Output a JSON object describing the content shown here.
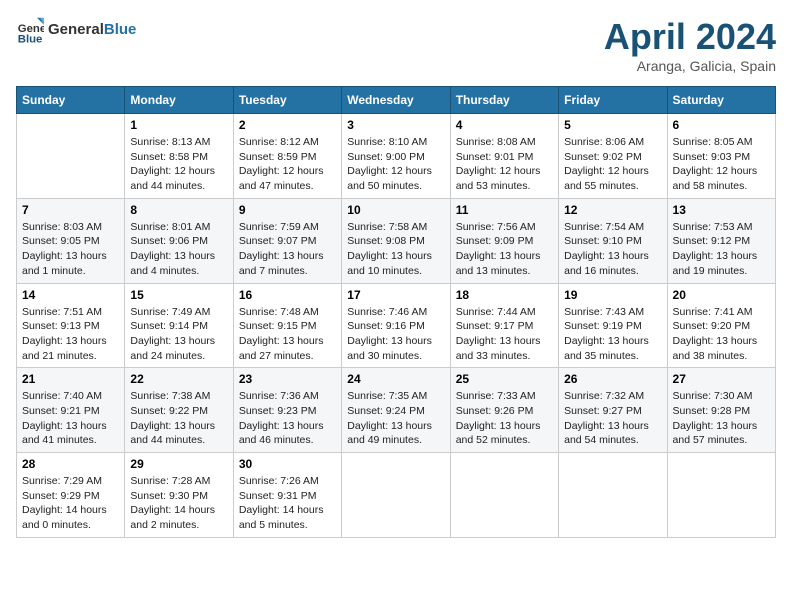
{
  "header": {
    "logo_general": "General",
    "logo_blue": "Blue",
    "month_title": "April 2024",
    "subtitle": "Aranga, Galicia, Spain"
  },
  "columns": [
    "Sunday",
    "Monday",
    "Tuesday",
    "Wednesday",
    "Thursday",
    "Friday",
    "Saturday"
  ],
  "weeks": [
    [
      {
        "day": "",
        "info": ""
      },
      {
        "day": "1",
        "info": "Sunrise: 8:13 AM\nSunset: 8:58 PM\nDaylight: 12 hours\nand 44 minutes."
      },
      {
        "day": "2",
        "info": "Sunrise: 8:12 AM\nSunset: 8:59 PM\nDaylight: 12 hours\nand 47 minutes."
      },
      {
        "day": "3",
        "info": "Sunrise: 8:10 AM\nSunset: 9:00 PM\nDaylight: 12 hours\nand 50 minutes."
      },
      {
        "day": "4",
        "info": "Sunrise: 8:08 AM\nSunset: 9:01 PM\nDaylight: 12 hours\nand 53 minutes."
      },
      {
        "day": "5",
        "info": "Sunrise: 8:06 AM\nSunset: 9:02 PM\nDaylight: 12 hours\nand 55 minutes."
      },
      {
        "day": "6",
        "info": "Sunrise: 8:05 AM\nSunset: 9:03 PM\nDaylight: 12 hours\nand 58 minutes."
      }
    ],
    [
      {
        "day": "7",
        "info": "Sunrise: 8:03 AM\nSunset: 9:05 PM\nDaylight: 13 hours\nand 1 minute."
      },
      {
        "day": "8",
        "info": "Sunrise: 8:01 AM\nSunset: 9:06 PM\nDaylight: 13 hours\nand 4 minutes."
      },
      {
        "day": "9",
        "info": "Sunrise: 7:59 AM\nSunset: 9:07 PM\nDaylight: 13 hours\nand 7 minutes."
      },
      {
        "day": "10",
        "info": "Sunrise: 7:58 AM\nSunset: 9:08 PM\nDaylight: 13 hours\nand 10 minutes."
      },
      {
        "day": "11",
        "info": "Sunrise: 7:56 AM\nSunset: 9:09 PM\nDaylight: 13 hours\nand 13 minutes."
      },
      {
        "day": "12",
        "info": "Sunrise: 7:54 AM\nSunset: 9:10 PM\nDaylight: 13 hours\nand 16 minutes."
      },
      {
        "day": "13",
        "info": "Sunrise: 7:53 AM\nSunset: 9:12 PM\nDaylight: 13 hours\nand 19 minutes."
      }
    ],
    [
      {
        "day": "14",
        "info": "Sunrise: 7:51 AM\nSunset: 9:13 PM\nDaylight: 13 hours\nand 21 minutes."
      },
      {
        "day": "15",
        "info": "Sunrise: 7:49 AM\nSunset: 9:14 PM\nDaylight: 13 hours\nand 24 minutes."
      },
      {
        "day": "16",
        "info": "Sunrise: 7:48 AM\nSunset: 9:15 PM\nDaylight: 13 hours\nand 27 minutes."
      },
      {
        "day": "17",
        "info": "Sunrise: 7:46 AM\nSunset: 9:16 PM\nDaylight: 13 hours\nand 30 minutes."
      },
      {
        "day": "18",
        "info": "Sunrise: 7:44 AM\nSunset: 9:17 PM\nDaylight: 13 hours\nand 33 minutes."
      },
      {
        "day": "19",
        "info": "Sunrise: 7:43 AM\nSunset: 9:19 PM\nDaylight: 13 hours\nand 35 minutes."
      },
      {
        "day": "20",
        "info": "Sunrise: 7:41 AM\nSunset: 9:20 PM\nDaylight: 13 hours\nand 38 minutes."
      }
    ],
    [
      {
        "day": "21",
        "info": "Sunrise: 7:40 AM\nSunset: 9:21 PM\nDaylight: 13 hours\nand 41 minutes."
      },
      {
        "day": "22",
        "info": "Sunrise: 7:38 AM\nSunset: 9:22 PM\nDaylight: 13 hours\nand 44 minutes."
      },
      {
        "day": "23",
        "info": "Sunrise: 7:36 AM\nSunset: 9:23 PM\nDaylight: 13 hours\nand 46 minutes."
      },
      {
        "day": "24",
        "info": "Sunrise: 7:35 AM\nSunset: 9:24 PM\nDaylight: 13 hours\nand 49 minutes."
      },
      {
        "day": "25",
        "info": "Sunrise: 7:33 AM\nSunset: 9:26 PM\nDaylight: 13 hours\nand 52 minutes."
      },
      {
        "day": "26",
        "info": "Sunrise: 7:32 AM\nSunset: 9:27 PM\nDaylight: 13 hours\nand 54 minutes."
      },
      {
        "day": "27",
        "info": "Sunrise: 7:30 AM\nSunset: 9:28 PM\nDaylight: 13 hours\nand 57 minutes."
      }
    ],
    [
      {
        "day": "28",
        "info": "Sunrise: 7:29 AM\nSunset: 9:29 PM\nDaylight: 14 hours\nand 0 minutes."
      },
      {
        "day": "29",
        "info": "Sunrise: 7:28 AM\nSunset: 9:30 PM\nDaylight: 14 hours\nand 2 minutes."
      },
      {
        "day": "30",
        "info": "Sunrise: 7:26 AM\nSunset: 9:31 PM\nDaylight: 14 hours\nand 5 minutes."
      },
      {
        "day": "",
        "info": ""
      },
      {
        "day": "",
        "info": ""
      },
      {
        "day": "",
        "info": ""
      },
      {
        "day": "",
        "info": ""
      }
    ]
  ]
}
